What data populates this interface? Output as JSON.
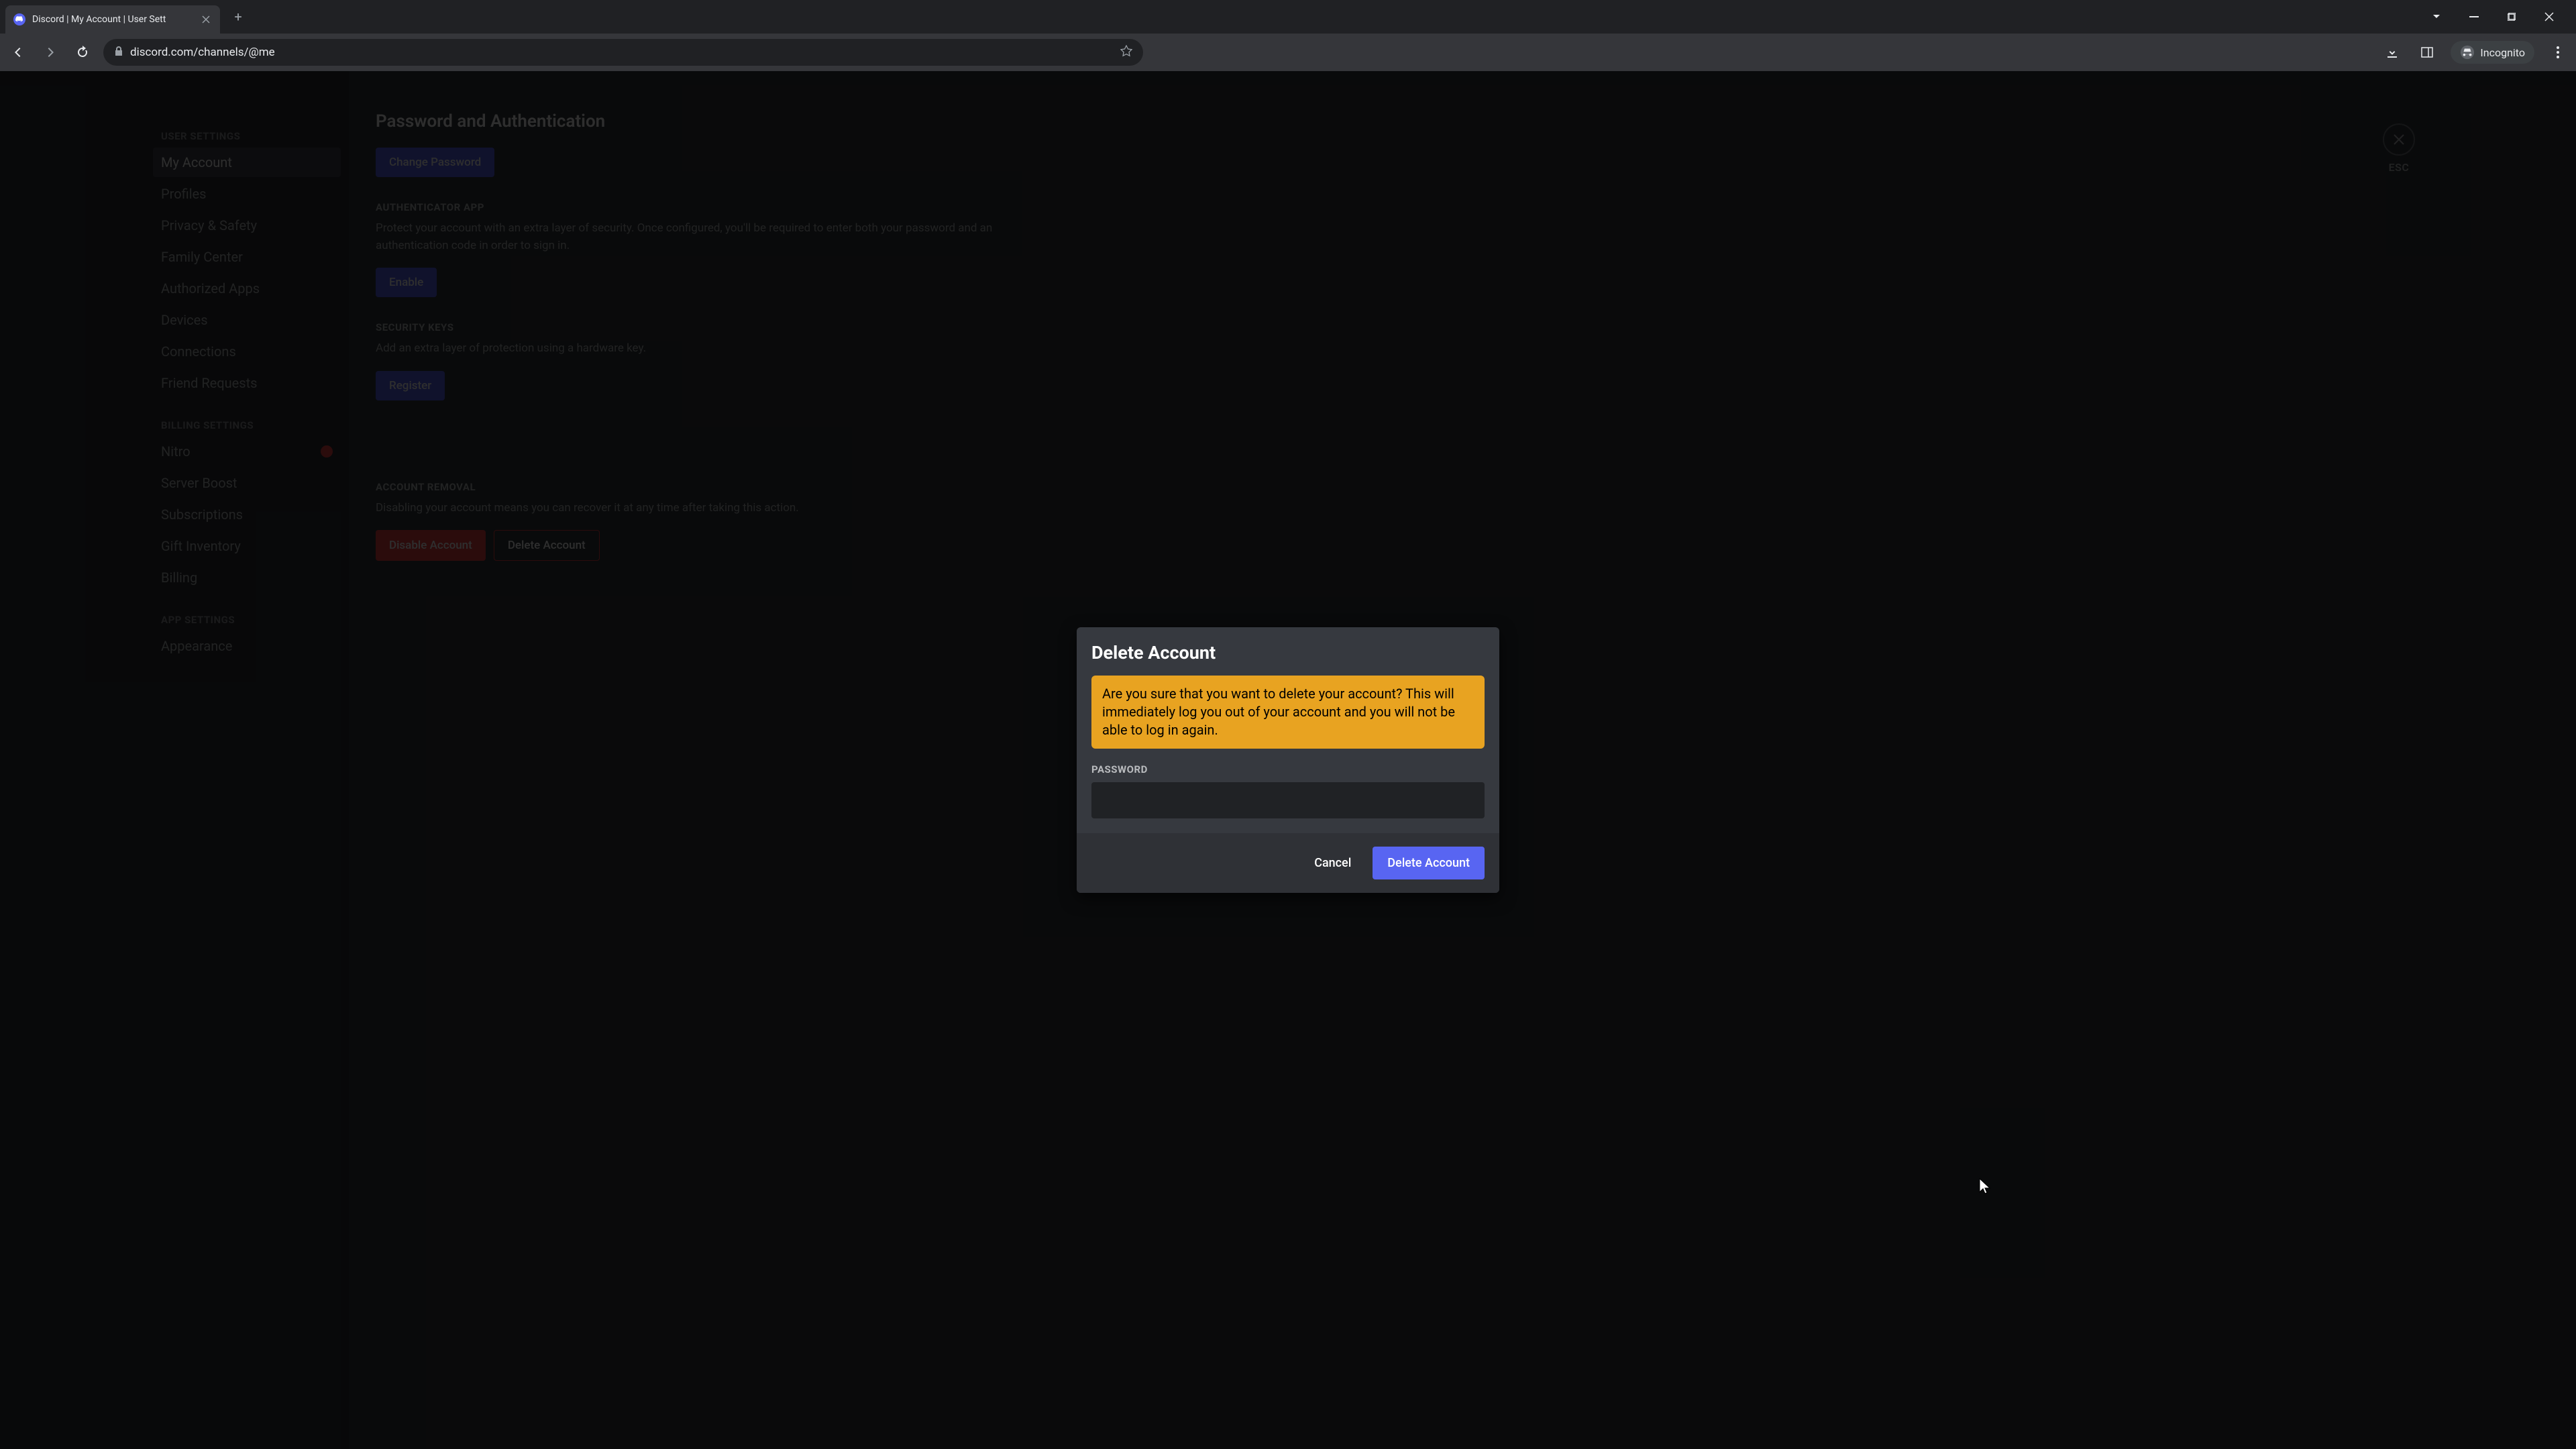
{
  "browser": {
    "tab_title": "Discord | My Account | User Sett",
    "url": "discord.com/channels/@me",
    "incognito_label": "Incognito"
  },
  "sidebar": {
    "groups": [
      {
        "header": "USER SETTINGS",
        "items": [
          {
            "label": "My Account",
            "active": true
          },
          {
            "label": "Profiles"
          },
          {
            "label": "Privacy & Safety"
          },
          {
            "label": "Family Center"
          },
          {
            "label": "Authorized Apps"
          },
          {
            "label": "Devices"
          },
          {
            "label": "Connections"
          },
          {
            "label": "Friend Requests"
          }
        ]
      },
      {
        "header": "BILLING SETTINGS",
        "items": [
          {
            "label": "Nitro",
            "badge": true
          },
          {
            "label": "Server Boost"
          },
          {
            "label": "Subscriptions"
          },
          {
            "label": "Gift Inventory"
          },
          {
            "label": "Billing"
          }
        ]
      },
      {
        "header": "APP SETTINGS",
        "items": [
          {
            "label": "Appearance"
          }
        ]
      }
    ]
  },
  "content": {
    "title": "Password and Authentication",
    "change_password": "Change Password",
    "auth_app_label": "AUTHENTICATOR APP",
    "auth_app_desc": "Protect your account with an extra layer of security. Once configured, you'll be required to enter both your password and an authentication code in order to sign in.",
    "enable_btn": "Enable",
    "keys_label": "SECURITY KEYS",
    "keys_desc": "Add an extra layer of protection using a hardware key.",
    "register_btn": "Register",
    "removal_label": "ACCOUNT REMOVAL",
    "removal_desc": "Disabling your account means you can recover it at any time after taking this action.",
    "disable_btn": "Disable Account",
    "delete_btn": "Delete Account",
    "esc_label": "ESC"
  },
  "modal": {
    "title": "Delete Account",
    "warning": "Are you sure that you want to delete your account? This will immediately log you out of your account and you will not be able to log in again.",
    "password_label": "PASSWORD",
    "password_value": "",
    "cancel": "Cancel",
    "confirm": "Delete Account"
  }
}
